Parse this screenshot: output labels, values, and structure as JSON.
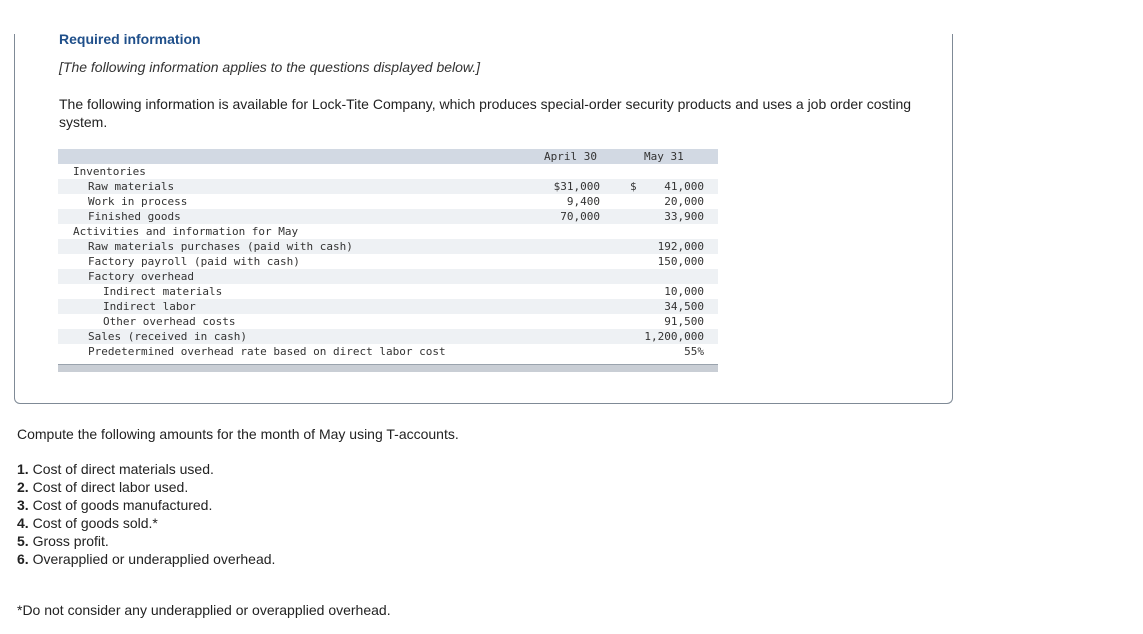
{
  "header": {
    "title": "Required information",
    "applies": "[The following information applies to the questions displayed below.]",
    "intro": "The following information is available for Lock-Tite Company, which produces special-order security products and uses a job order costing system."
  },
  "table": {
    "col1": "April 30",
    "col2": "May 31",
    "rows": [
      {
        "label": "Inventories",
        "indent": 0,
        "v1": "",
        "dollar": "",
        "v2": ""
      },
      {
        "label": "Raw materials",
        "indent": 1,
        "v1": "$31,000",
        "dollar": "$",
        "v2": "41,000"
      },
      {
        "label": "Work in process",
        "indent": 1,
        "v1": "9,400",
        "dollar": "",
        "v2": "20,000"
      },
      {
        "label": "Finished goods",
        "indent": 1,
        "v1": "70,000",
        "dollar": "",
        "v2": "33,900"
      },
      {
        "label": "Activities and information for May",
        "indent": 0,
        "v1": "",
        "dollar": "",
        "v2": ""
      },
      {
        "label": "Raw materials purchases (paid with cash)",
        "indent": 1,
        "v1": "",
        "dollar": "",
        "v2": "192,000"
      },
      {
        "label": "Factory payroll (paid with cash)",
        "indent": 1,
        "v1": "",
        "dollar": "",
        "v2": "150,000"
      },
      {
        "label": "Factory overhead",
        "indent": 1,
        "v1": "",
        "dollar": "",
        "v2": ""
      },
      {
        "label": "Indirect materials",
        "indent": 2,
        "v1": "",
        "dollar": "",
        "v2": "10,000"
      },
      {
        "label": "Indirect labor",
        "indent": 2,
        "v1": "",
        "dollar": "",
        "v2": "34,500"
      },
      {
        "label": "Other overhead costs",
        "indent": 2,
        "v1": "",
        "dollar": "",
        "v2": "91,500"
      },
      {
        "label": "Sales (received in cash)",
        "indent": 1,
        "v1": "",
        "dollar": "",
        "v2": "1,200,000"
      },
      {
        "label": "Predetermined overhead rate based on direct labor cost",
        "indent": 1,
        "v1": "",
        "dollar": "",
        "v2": "55%"
      }
    ]
  },
  "compute": "Compute the following amounts for the month of May using T-accounts.",
  "questions": [
    {
      "num": "1.",
      "text": "Cost of direct materials used."
    },
    {
      "num": "2.",
      "text": "Cost of direct labor used."
    },
    {
      "num": "3.",
      "text": "Cost of goods manufactured."
    },
    {
      "num": "4.",
      "text": "Cost of goods sold.*"
    },
    {
      "num": "5.",
      "text": "Gross profit."
    },
    {
      "num": "6.",
      "text": "Overapplied or underapplied overhead."
    }
  ],
  "note": "*Do not consider any underapplied or overapplied overhead."
}
